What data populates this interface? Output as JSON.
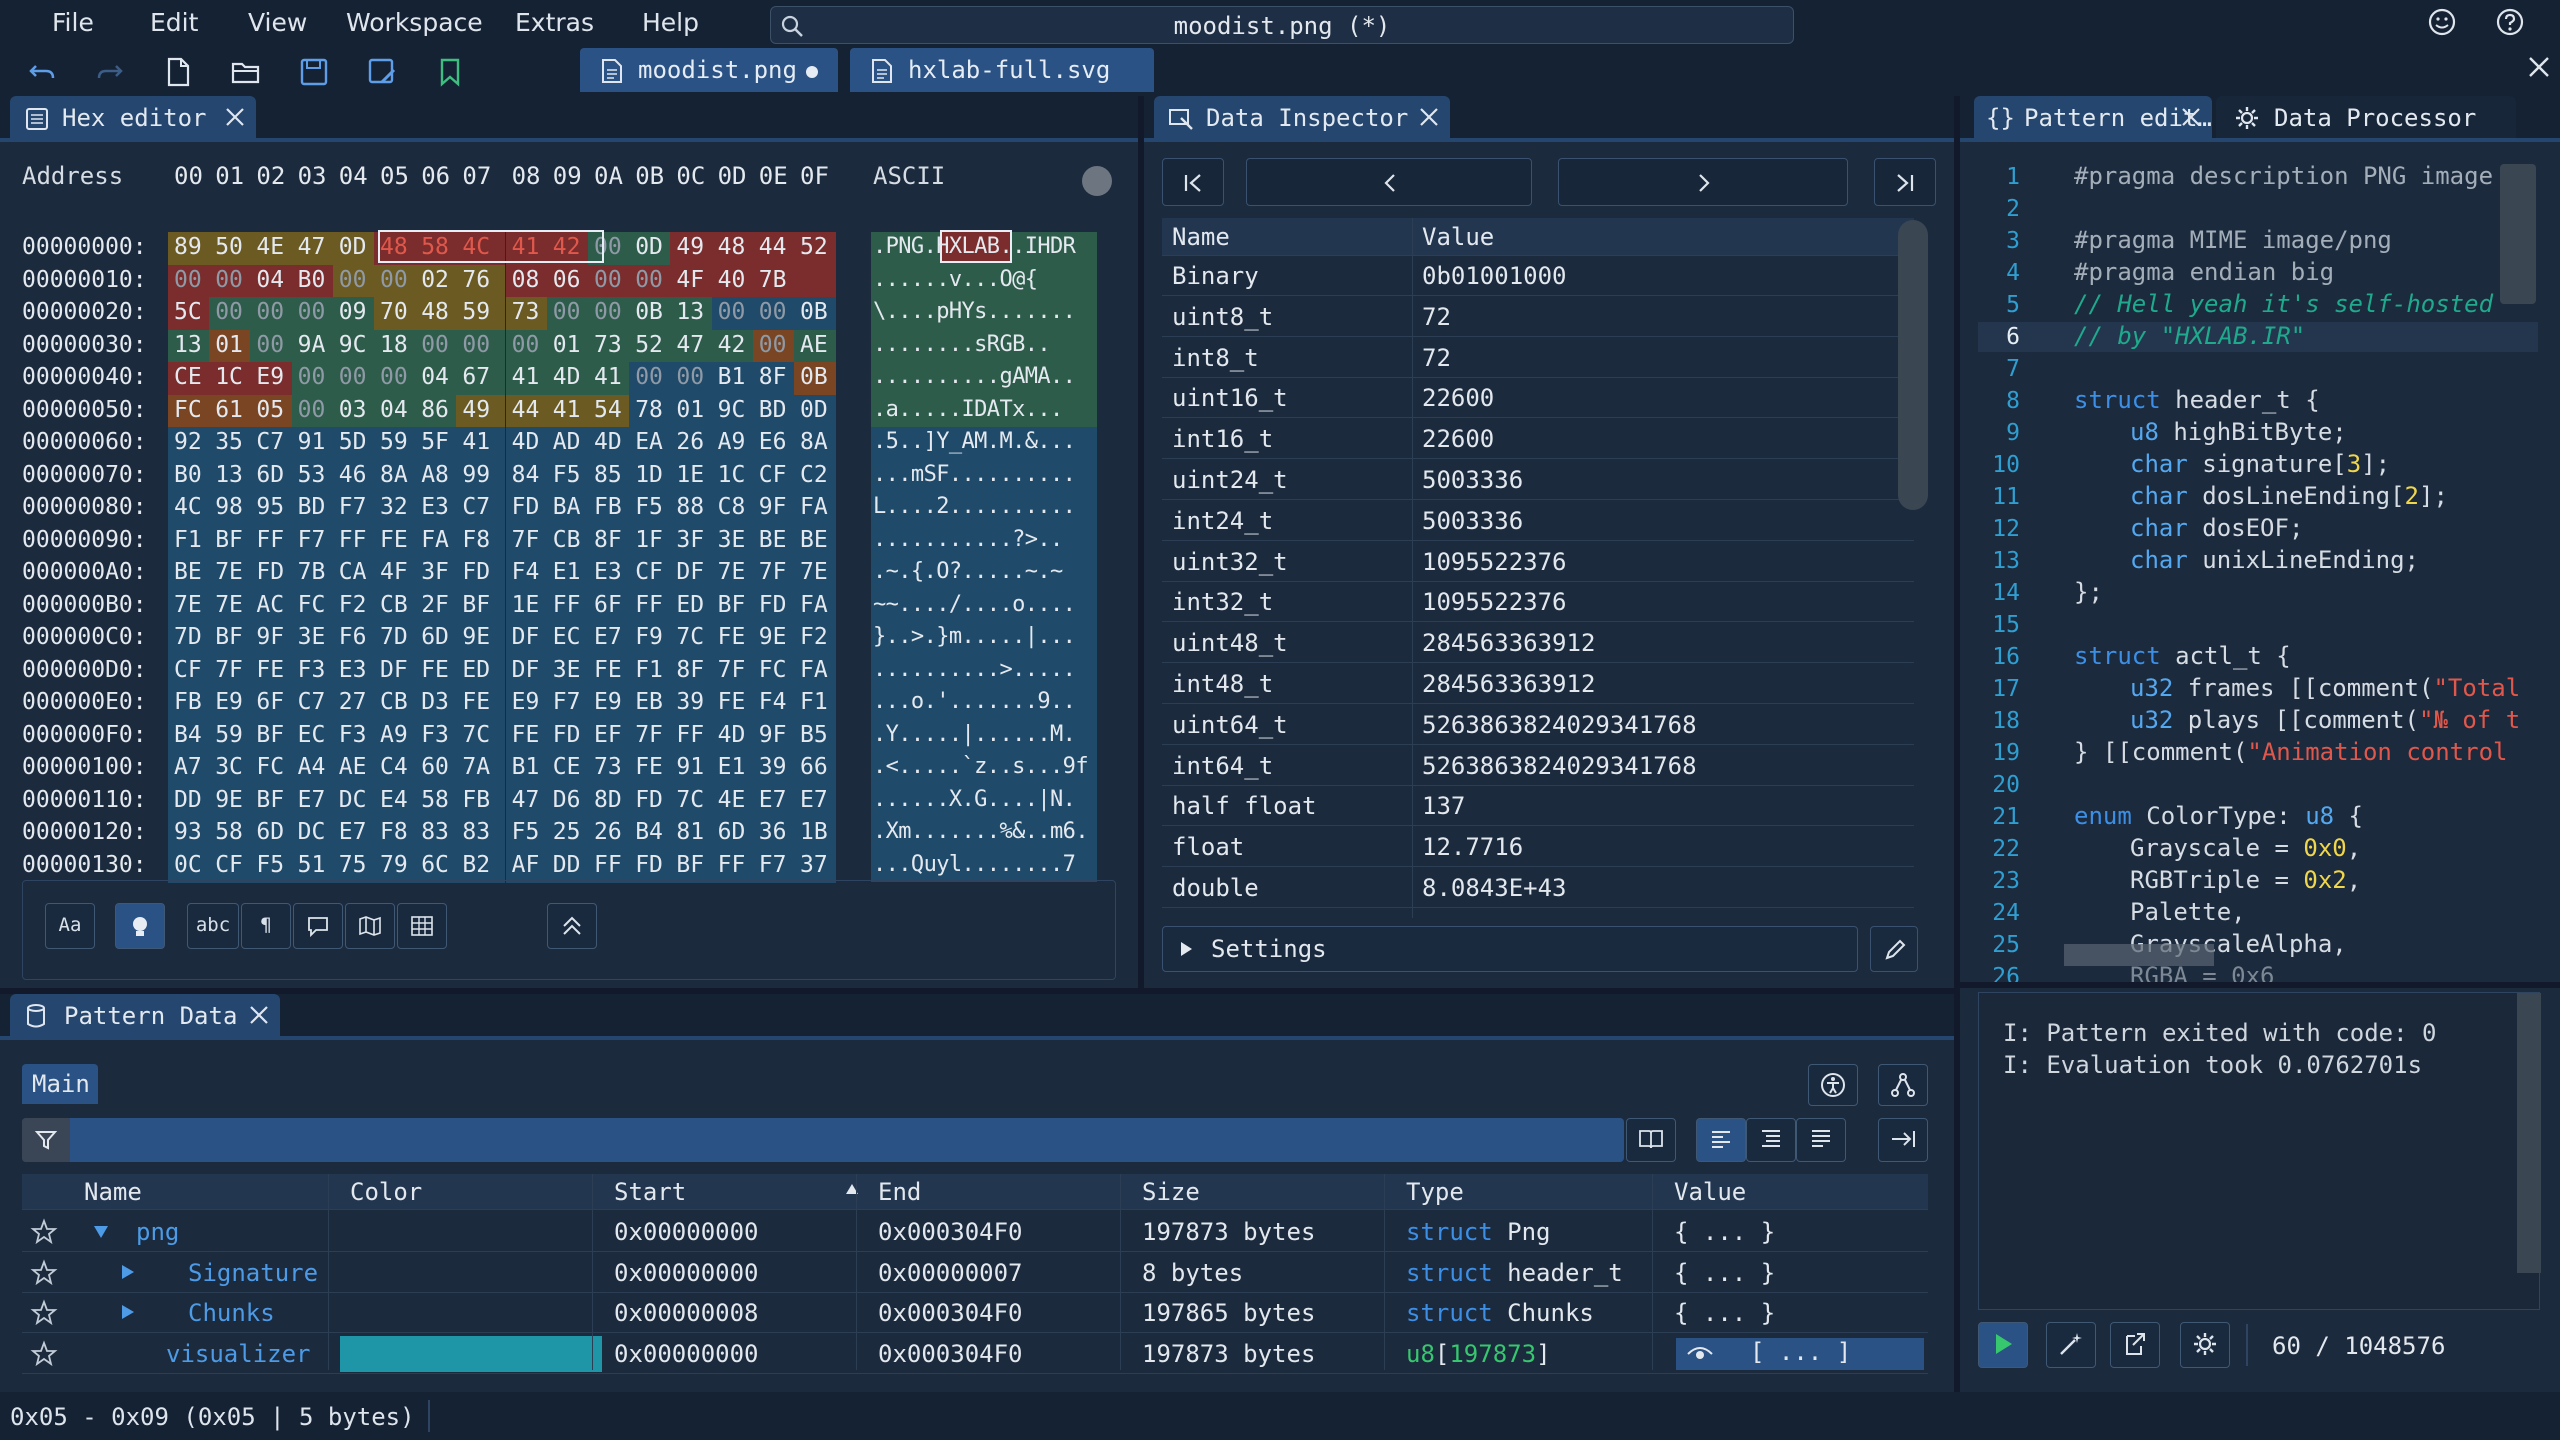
{
  "menu": {
    "file": "File",
    "edit": "Edit",
    "view": "View",
    "workspace": "Workspace",
    "extras": "Extras",
    "help": "Help"
  },
  "search": {
    "title": "moodist.png (*)"
  },
  "file_tabs": [
    {
      "label": "moodist.png"
    },
    {
      "label": "hxlab-full.svg"
    }
  ],
  "hex_editor": {
    "tab_label": "Hex editor",
    "address_header": "Address",
    "col_headers": [
      "00",
      "01",
      "02",
      "03",
      "04",
      "05",
      "06",
      "07",
      "08",
      "09",
      "0A",
      "0B",
      "0C",
      "0D",
      "0E",
      "0F"
    ],
    "ascii_header": "ASCII",
    "addresses": [
      "00000000:",
      "00000010:",
      "00000020:",
      "00000030:",
      "00000040:",
      "00000050:",
      "00000060:",
      "00000070:",
      "00000080:",
      "00000090:",
      "000000A0:",
      "000000B0:",
      "000000C0:",
      "000000D0:",
      "000000E0:",
      "000000F0:",
      "00000100:",
      "00000110:",
      "00000120:",
      "00000130:"
    ],
    "rows": [
      [
        "89",
        "50",
        "4E",
        "47",
        "0D",
        "48",
        "58",
        "4C",
        "41",
        "42",
        "00",
        "0D",
        "49",
        "48",
        "44",
        "52"
      ],
      [
        "00",
        "00",
        "04",
        "B0",
        "00",
        "00",
        "02",
        "76",
        "08",
        "06",
        "00",
        "00",
        "4F",
        "40",
        "7B",
        ""
      ],
      [
        "5C",
        "00",
        "00",
        "00",
        "09",
        "70",
        "48",
        "59",
        "73",
        "00",
        "00",
        "0B",
        "13",
        "00",
        "00",
        "0B"
      ],
      [
        "13",
        "01",
        "00",
        "9A",
        "9C",
        "18",
        "00",
        "00",
        "00",
        "01",
        "73",
        "52",
        "47",
        "42",
        "00",
        "AE"
      ],
      [
        "CE",
        "1C",
        "E9",
        "00",
        "00",
        "00",
        "04",
        "67",
        "41",
        "4D",
        "41",
        "00",
        "00",
        "B1",
        "8F",
        "0B"
      ],
      [
        "FC",
        "61",
        "05",
        "00",
        "03",
        "04",
        "86",
        "49",
        "44",
        "41",
        "54",
        "78",
        "01",
        "9C",
        "BD",
        "0D"
      ],
      [
        "92",
        "35",
        "C7",
        "91",
        "5D",
        "59",
        "5F",
        "41",
        "4D",
        "AD",
        "4D",
        "EA",
        "26",
        "A9",
        "E6",
        "8A"
      ],
      [
        "B0",
        "13",
        "6D",
        "53",
        "46",
        "8A",
        "A8",
        "99",
        "84",
        "F5",
        "85",
        "1D",
        "1E",
        "1C",
        "CF",
        "C2"
      ],
      [
        "4C",
        "98",
        "95",
        "BD",
        "F7",
        "32",
        "E3",
        "C7",
        "FD",
        "BA",
        "FB",
        "F5",
        "88",
        "C8",
        "9F",
        "FA"
      ],
      [
        "F1",
        "BF",
        "FF",
        "F7",
        "FF",
        "FE",
        "FA",
        "F8",
        "7F",
        "CB",
        "8F",
        "1F",
        "3F",
        "3E",
        "BE",
        "BE"
      ],
      [
        "BE",
        "7E",
        "FD",
        "7B",
        "CA",
        "4F",
        "3F",
        "FD",
        "F4",
        "E1",
        "E3",
        "CF",
        "DF",
        "7E",
        "7F",
        "7E"
      ],
      [
        "7E",
        "7E",
        "AC",
        "FC",
        "F2",
        "CB",
        "2F",
        "BF",
        "1E",
        "FF",
        "6F",
        "FF",
        "ED",
        "BF",
        "FD",
        "FA"
      ],
      [
        "7D",
        "BF",
        "9F",
        "3E",
        "F6",
        "7D",
        "6D",
        "9E",
        "DF",
        "EC",
        "E7",
        "F9",
        "7C",
        "FE",
        "9E",
        "F2"
      ],
      [
        "CF",
        "7F",
        "FE",
        "F3",
        "E3",
        "DF",
        "FE",
        "ED",
        "DF",
        "3E",
        "FE",
        "F1",
        "8F",
        "7F",
        "FC",
        "FA"
      ],
      [
        "FB",
        "E9",
        "6F",
        "C7",
        "27",
        "CB",
        "D3",
        "FE",
        "E9",
        "F7",
        "E9",
        "EB",
        "39",
        "FE",
        "F4",
        "F1"
      ],
      [
        "B4",
        "59",
        "BF",
        "EC",
        "F3",
        "A9",
        "F3",
        "7C",
        "FE",
        "FD",
        "EF",
        "7F",
        "FF",
        "4D",
        "9F",
        "B5"
      ],
      [
        "A7",
        "3C",
        "FC",
        "A4",
        "AE",
        "C4",
        "60",
        "7A",
        "B1",
        "CE",
        "73",
        "FE",
        "91",
        "E1",
        "39",
        "66"
      ],
      [
        "DD",
        "9E",
        "BF",
        "E7",
        "DC",
        "E4",
        "58",
        "FB",
        "47",
        "D6",
        "8D",
        "FD",
        "7C",
        "4E",
        "E7",
        "E7"
      ],
      [
        "93",
        "58",
        "6D",
        "DC",
        "E7",
        "F8",
        "83",
        "83",
        "F5",
        "25",
        "26",
        "B4",
        "81",
        "6D",
        "36",
        "1B"
      ],
      [
        "0C",
        "CF",
        "F5",
        "51",
        "75",
        "79",
        "6C",
        "B2",
        "AF",
        "DD",
        "FF",
        "FD",
        "BF",
        "FF",
        "F7",
        "37"
      ]
    ],
    "ascii": [
      ".PNG.HXLAB..IHDR",
      "......v...O@{",
      "\\....pHYs.......",
      "........sRGB..",
      "..........gAMA..",
      ".a.....IDATx...",
      ".5..]Y_AM.M.&...",
      "...mSF..........",
      "L....2..........",
      "...........?>..",
      ".~.{.O?.....~.~",
      "~~..../....o....",
      "}..>.}m.....|...",
      "..........>.....",
      "...o.'.......9..",
      ".Y.....|......M.",
      ".<.....`z..s...9f",
      "......X.G....|N.",
      ".Xm.......%&..m6.",
      "...Quyl........7"
    ],
    "tools": [
      "Aa",
      "abc"
    ]
  },
  "inspector": {
    "tab_label": "Data Inspector",
    "col_name": "Name",
    "col_value": "Value",
    "rows": [
      {
        "name": "Binary",
        "value": "0b01001000"
      },
      {
        "name": "uint8_t",
        "value": "72"
      },
      {
        "name": "int8_t",
        "value": "72"
      },
      {
        "name": "uint16_t",
        "value": "22600"
      },
      {
        "name": "int16_t",
        "value": "22600"
      },
      {
        "name": "uint24_t",
        "value": "5003336"
      },
      {
        "name": "int24_t",
        "value": "5003336"
      },
      {
        "name": "uint32_t",
        "value": "1095522376"
      },
      {
        "name": "int32_t",
        "value": "1095522376"
      },
      {
        "name": "uint48_t",
        "value": "284563363912"
      },
      {
        "name": "int48_t",
        "value": "284563363912"
      },
      {
        "name": "uint64_t",
        "value": "5263863824029341768"
      },
      {
        "name": "int64_t",
        "value": "5263863824029341768"
      },
      {
        "name": "half float",
        "value": "137"
      },
      {
        "name": "float",
        "value": "12.7716"
      },
      {
        "name": "double",
        "value": "8.0843E+43"
      }
    ],
    "settings_label": "Settings"
  },
  "pattern_editor": {
    "tab_label": "Pattern edit…",
    "tab2_label": "Data Processor",
    "line_numbers": [
      "1",
      "2",
      "3",
      "4",
      "5",
      "6",
      "7",
      "8",
      "9",
      "10",
      "11",
      "12",
      "13",
      "14",
      "15",
      "16",
      "17",
      "18",
      "19",
      "20",
      "21",
      "22",
      "23",
      "24",
      "25",
      "26"
    ],
    "console": [
      "I: Pattern exited with code: 0",
      "I: Evaluation took 0.0762701s"
    ],
    "counter": "60 / 1048576",
    "code": {
      "l1": "#pragma description PNG image",
      "l3": "#pragma MIME image/png",
      "l4": "#pragma endian big",
      "l5": "// Hell yeah it's self-hosted",
      "l6": "// by \"HXLAB.IR\"",
      "kw_struct": "struct",
      "kw_enum": "enum",
      "t_u8": "u8",
      "t_char": "char",
      "t_u32": "u32",
      "l8b": " header_t {",
      "l9b": " highBitByte;",
      "l10b": " signature[",
      "n3": "3",
      "l10c": "];",
      "l11b": " dosLineEnding[",
      "n2": "2",
      "l11c": "];",
      "l12b": " dosEOF;",
      "l13b": " unixLineEnding;",
      "l14": "};",
      "l16b": " actl_t {",
      "l17b": " frames [[comment(",
      "s17": "\"Total №",
      "l18b": " plays [[comment(",
      "s18": "\"№ of tim",
      "l19a": "} [[comment(",
      "s19": "\"Animation control ch",
      "l21b": " ColorType: ",
      "l21c": " {",
      "l22a": "Grayscale = ",
      "n0": "0x0",
      "comma": ",",
      "l23a": "RGBTriple = ",
      "n2b": "0x2",
      "l24a": "Palette,",
      "l25a": "GrayscaleAlpha,",
      "l26a": "RGBA = 0x6"
    }
  },
  "pattern_data": {
    "tab_label": "Pattern Data",
    "subtab": "Main",
    "columns": [
      "Name",
      "Color",
      "Start",
      "End",
      "Size",
      "Type",
      "Value"
    ],
    "rows": [
      {
        "name": "png",
        "start": "0x00000000",
        "end": "0x000304F0",
        "size": "197873 bytes",
        "type_kw": "struct",
        "type_name": " Png",
        "value": "{ ... }"
      },
      {
        "name": "Signature",
        "start": "0x00000000",
        "end": "0x00000007",
        "size": "8 bytes",
        "type_kw": "struct",
        "type_name": " header_t",
        "value": "{ ... }"
      },
      {
        "name": "Chunks",
        "start": "0x00000008",
        "end": "0x000304F0",
        "size": "197865 bytes",
        "type_kw": "struct",
        "type_name": " Chunks",
        "value": "{ ... }"
      },
      {
        "name": "visualizer",
        "start": "0x00000000",
        "end": "0x000304F0",
        "size": "197873 bytes",
        "type_kw": "u8",
        "type_br": "[",
        "type_num": "197873",
        "type_br2": "]",
        "value": "[ ... ]"
      }
    ],
    "colors": {
      "visualizer": "#1f95a8"
    }
  },
  "status": {
    "selection": "0x05 - 0x09 (0x05 | 5 bytes)"
  },
  "colors": {
    "accent": "#2a5285",
    "bg": "#1b2a3d",
    "hex_highlight": "#e0584c"
  }
}
